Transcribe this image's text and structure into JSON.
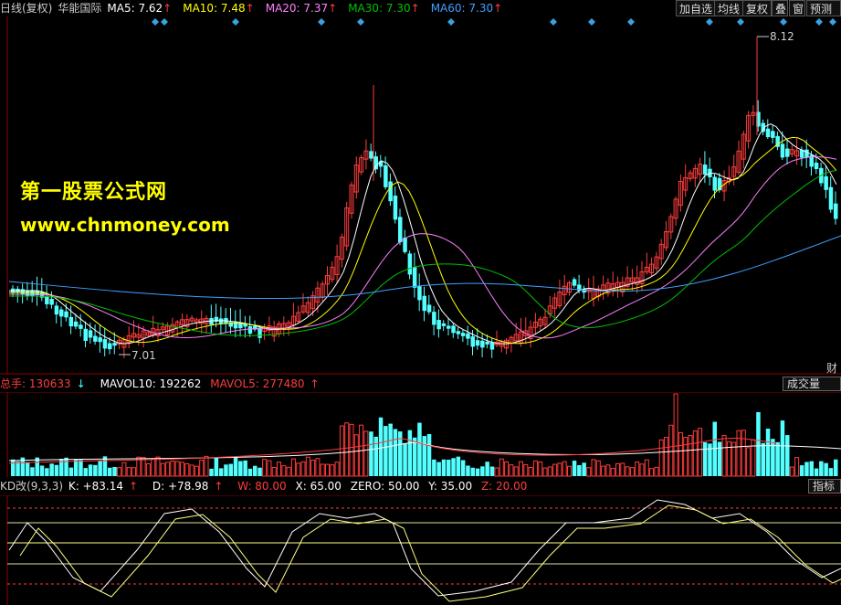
{
  "colors": {
    "up": "#ff3c3c",
    "down": "#54ffff",
    "ma5": "#ffffff",
    "ma10": "#ffff00",
    "ma20": "#ff80ff",
    "ma30": "#00c000",
    "ma60": "#40a0ff",
    "grid": "#8b0000"
  },
  "header": {
    "period_label": "日线(复权)",
    "stock_name": "华能国际",
    "ma": [
      {
        "label": "MA5: 7.62",
        "arrow": "↑",
        "color": "#ffffff"
      },
      {
        "label": "MA10: 7.48",
        "arrow": "↑",
        "color": "#ffff00"
      },
      {
        "label": "MA20: 7.37",
        "arrow": "↑",
        "color": "#ff80ff"
      },
      {
        "label": "MA30: 7.30",
        "arrow": "↑",
        "color": "#00c000"
      },
      {
        "label": "MA60: 7.30",
        "arrow": "↑",
        "color": "#40a0ff"
      }
    ],
    "buttons": [
      "加自选",
      "均线",
      "复权",
      "叠",
      "窗",
      "预测"
    ]
  },
  "price_panel": {
    "high_label": "8.12",
    "low_label": "7.01",
    "right_tag": "财"
  },
  "watermark": {
    "line1": "第一股票公式网",
    "line2": "www.chnmoney.com"
  },
  "volume_panel": {
    "total_label": "总手: 130633",
    "total_arrow": "↓",
    "mavol10_label": "MAVOL10: 192262",
    "mavol5_label": "MAVOL5: 277480",
    "mavol5_arrow": "↑",
    "button": "成交量"
  },
  "kd_panel": {
    "name": "KD改(9,3,3)",
    "k_label": "K: +83.14",
    "k_arrow": "↑",
    "d_label": "D: +78.98",
    "d_arrow": "↑",
    "w_label": "W: 80.00",
    "x_label": "X: 65.00",
    "zero_label": "ZERO: 50.00",
    "y_label": "Y: 35.00",
    "z_label": "Z: 20.00",
    "button": "指标说"
  }
}
